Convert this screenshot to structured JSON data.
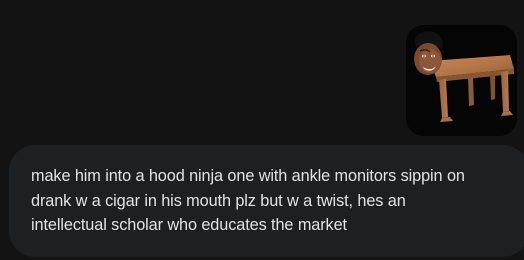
{
  "conversation": {
    "user_message": {
      "attachment": {
        "kind": "image",
        "icon": "attached-image-thumbnail"
      },
      "text_lines": [
        "make him into a hood ninja one with ankle monitors sippin on",
        "drank w a cigar in his mouth plz but w a twist, hes an",
        "intellectual scholar who educates the market"
      ]
    }
  },
  "colors": {
    "background": "#131314",
    "bubble": "#1e1f20",
    "text": "#e3e3e3"
  }
}
